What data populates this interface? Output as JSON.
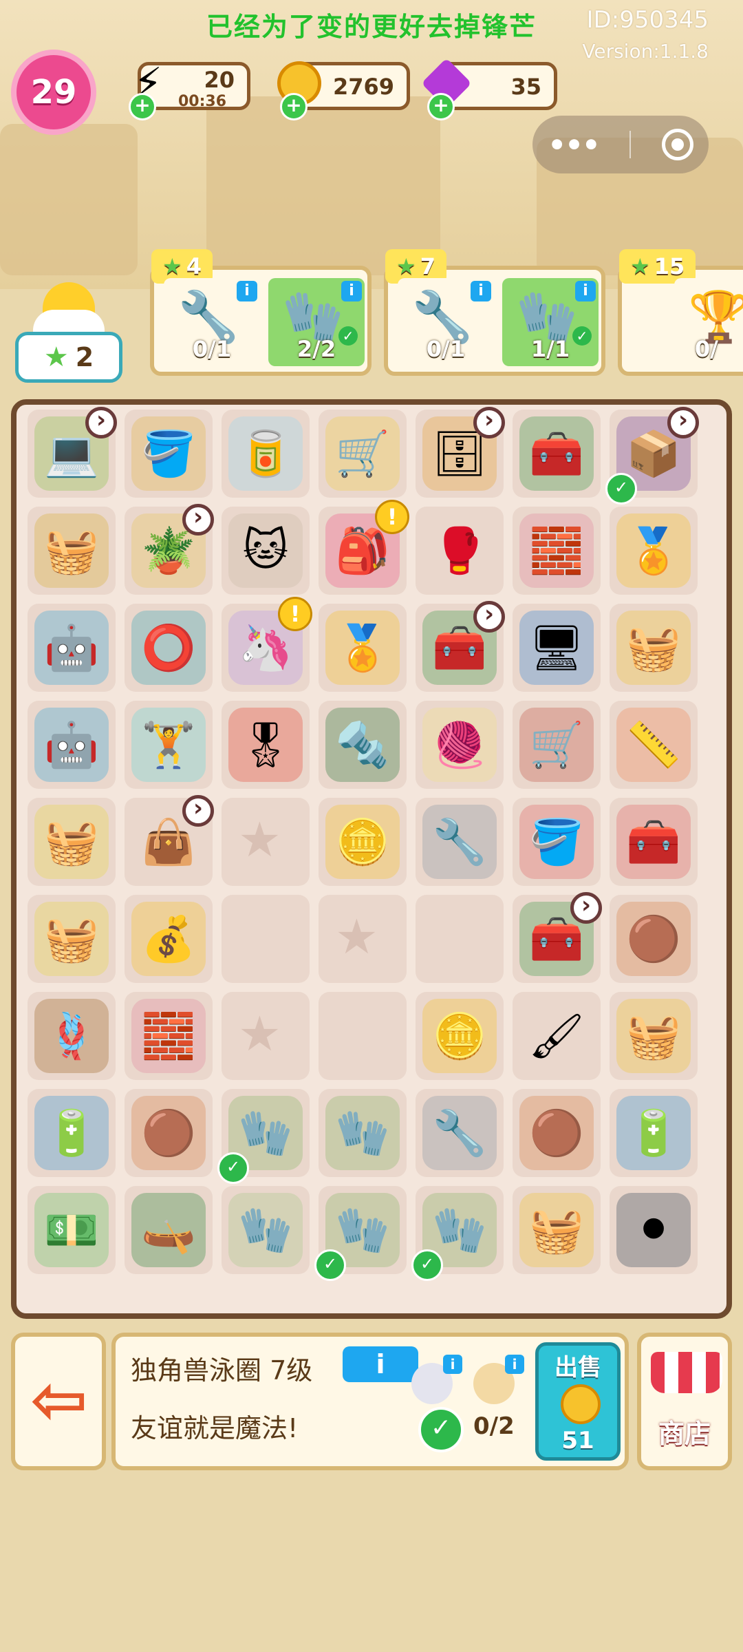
{
  "header": {
    "headline": "已经为了变的更好去掉锋芒",
    "id_label": "ID:950345",
    "version": "Version:1.1.8"
  },
  "level": "29",
  "resources": {
    "energy": {
      "value": "20",
      "timer": "00:36",
      "icon": "lightning-icon"
    },
    "coins": {
      "value": "2769",
      "icon": "coin-icon"
    },
    "gems": {
      "value": "35",
      "icon": "gem-icon"
    }
  },
  "player": {
    "stars": "2"
  },
  "orders": [
    {
      "stars": "4",
      "items": [
        {
          "name": "drill",
          "count": "0/1"
        },
        {
          "name": "gloves",
          "count": "2/2",
          "done": true
        }
      ]
    },
    {
      "stars": "7",
      "items": [
        {
          "name": "drill",
          "count": "0/1"
        },
        {
          "name": "gloves",
          "count": "1/1",
          "done": true
        }
      ]
    },
    {
      "stars": "15",
      "items": [
        {
          "name": "trophy",
          "count": "0/"
        }
      ]
    }
  ],
  "board": {
    "rows": [
      [
        "laptop",
        "bucket",
        "paint-can",
        "cart",
        "cabinet",
        "toolbox",
        "junk-pile"
      ],
      [
        "flower-basket",
        "plant-pot",
        "cat-float",
        "backpack",
        "boxing-glove",
        "bricks",
        "medal"
      ],
      [
        "robot-vacuum",
        "hula-hoop",
        "unicorn-float",
        "medal",
        "tool-case",
        "cpu-chip",
        "basket"
      ],
      [
        "robot-vacuum",
        "dumbbell",
        "rosette",
        "pipe",
        "yarn",
        "wheelbarrow",
        "tape-measure"
      ],
      [
        "tool-basket",
        "gym-bag",
        "",
        "coins",
        "wrench",
        "tool-bucket",
        "tool-tray"
      ],
      [
        "tool-basket",
        "coin-pile",
        "",
        "",
        "",
        "tool-case",
        "clay"
      ],
      [
        "rope",
        "bricks",
        "",
        "",
        "coin",
        "paint-roller",
        "basket"
      ],
      [
        "capacitor",
        "clay",
        "gloves",
        "gloves",
        "wrench",
        "clay",
        "capacitor"
      ],
      [
        "cash",
        "hull",
        "glove",
        "gloves",
        "gloves",
        "basket",
        "hose"
      ]
    ]
  },
  "selected": {
    "name": "独角兽泳圈 7级",
    "info_label": "i",
    "description": "友谊就是魔法!",
    "progress": "0/2",
    "sell_label": "出售",
    "sell_price": "51"
  },
  "shop_label": "商店",
  "colors": {
    "accent": "#22c22d",
    "board_border": "#6e4a2e",
    "sell": "#2ec3d6"
  }
}
